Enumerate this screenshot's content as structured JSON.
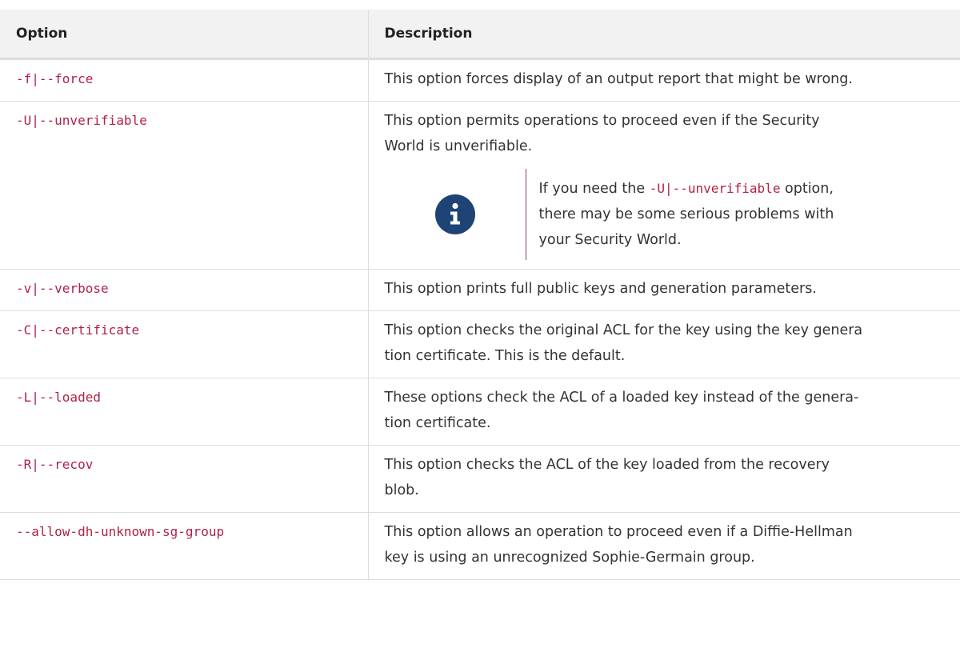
{
  "table": {
    "headers": [
      "Option",
      "Description"
    ],
    "rows": [
      {
        "option": "-f|--force",
        "lines": [
          "This option forces display of an output report that might be wrong."
        ]
      },
      {
        "option": "-U|--unverifiable",
        "lines": [
          "This option permits operations to proceed even if the Security",
          "World is unverifiable."
        ],
        "note": {
          "icon": "info-icon",
          "prefix": "If you need the ",
          "code": "-U|--unverifiable",
          "suffix": " option,",
          "lines": [
            "there may be some serious problems with",
            "your Security World."
          ]
        }
      },
      {
        "option": "-v|--verbose",
        "lines": [
          "This option prints full public keys and generation parameters."
        ]
      },
      {
        "option": "-C|--certificate",
        "lines": [
          "This option checks the original ACL for the key using the key genera",
          "tion certificate. This is the default."
        ]
      },
      {
        "option": "-L|--loaded",
        "lines": [
          "These options check the ACL of a loaded key instead of the genera-",
          "tion certificate."
        ]
      },
      {
        "option": "-R|--recov",
        "lines": [
          "This option checks the ACL of the key loaded from the recovery",
          "blob."
        ]
      },
      {
        "option": "--allow-dh-unknown-sg-group",
        "lines": [
          "This option allows an operation to proceed even if a Diffie-Hellman",
          "key is using an unrecognized Sophie-Germain group."
        ]
      }
    ]
  },
  "colors": {
    "code": "#b12146",
    "icon_bg": "#1d4475",
    "note_rule": "#8e3b7d",
    "header_bg": "#f2f2f2"
  }
}
